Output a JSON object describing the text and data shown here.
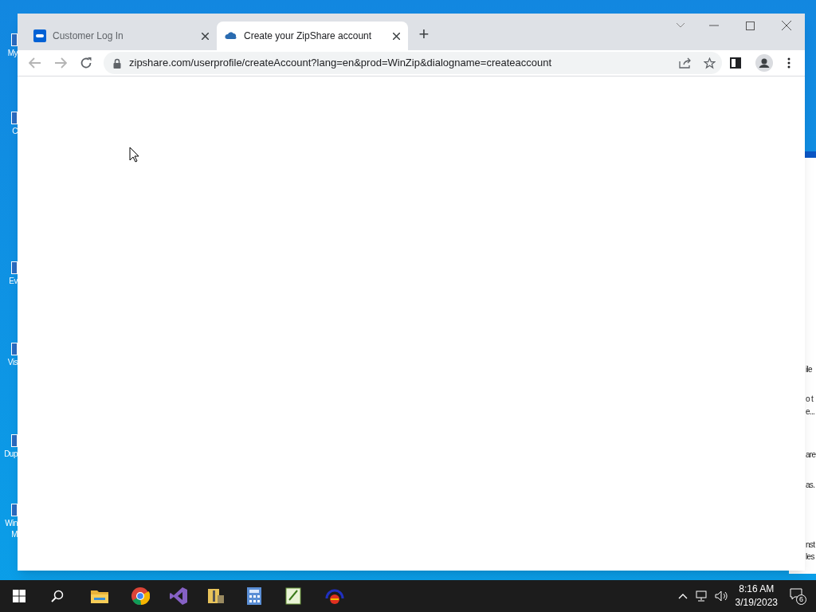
{
  "desktop_icons": [
    {
      "label": "My"
    },
    {
      "label": "C"
    },
    {
      "label": "Ev"
    },
    {
      "label": "Vis"
    },
    {
      "label": "Dup"
    },
    {
      "label": "Win M"
    }
  ],
  "background_window": {
    "texts": [
      "ile",
      "o t",
      "e...",
      "are",
      "as.",
      "nst",
      "les"
    ]
  },
  "browser": {
    "tabs": [
      {
        "title": "Customer Log In",
        "selected": false,
        "kind": "box"
      },
      {
        "title": "Create your ZipShare account",
        "selected": true,
        "kind": "cloud"
      }
    ],
    "new_tab": "+",
    "url": "zipshare.com/userprofile/createAccount?lang=en&prod=WinZip&dialogname=createaccount"
  },
  "taskbar": {
    "time": "8:16 AM",
    "date": "3/19/2023",
    "notifications": "6"
  }
}
